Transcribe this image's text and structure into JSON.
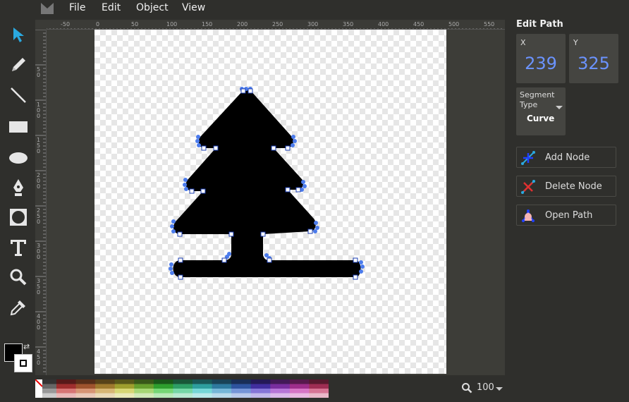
{
  "menubar": {
    "items": [
      "File",
      "Edit",
      "Object",
      "View"
    ]
  },
  "tools": {
    "items": [
      {
        "name": "select",
        "icon": "pointer-icon",
        "active": true
      },
      {
        "name": "pencil",
        "icon": "pencil-icon"
      },
      {
        "name": "line",
        "icon": "line-icon"
      },
      {
        "name": "rectangle",
        "icon": "rectangle-icon"
      },
      {
        "name": "ellipse",
        "icon": "ellipse-icon"
      },
      {
        "name": "path",
        "icon": "pen-icon"
      },
      {
        "name": "shapelib",
        "icon": "shape-library-icon"
      },
      {
        "name": "text",
        "icon": "text-icon"
      },
      {
        "name": "zoom",
        "icon": "magnifier-icon"
      },
      {
        "name": "eyedropper",
        "icon": "eyedropper-icon"
      }
    ],
    "fill_color": "#000000",
    "stroke_color": "#ffffff"
  },
  "rulers": {
    "top_labels": [
      "-50",
      "0",
      "50",
      "100",
      "150",
      "200",
      "250",
      "300",
      "350",
      "400",
      "450",
      "500",
      "550"
    ],
    "left_labels": [
      "50",
      "100",
      "150",
      "200",
      "250",
      "300",
      "350",
      "400",
      "450"
    ]
  },
  "panel": {
    "title": "Edit Path",
    "x_label": "X",
    "x_value": "239",
    "y_label": "Y",
    "y_value": "325",
    "segment_label": "Segment Type",
    "segment_value": "Curve",
    "buttons": [
      {
        "label": "Add Node",
        "icon": "add-node-icon"
      },
      {
        "label": "Delete Node",
        "icon": "delete-node-icon"
      },
      {
        "label": "Open Path",
        "icon": "open-path-icon"
      }
    ]
  },
  "zoom": {
    "value": "100"
  },
  "colors": {
    "accent": "#6b93ff",
    "node": "#4b7bec",
    "background": "#2f2f2c"
  }
}
